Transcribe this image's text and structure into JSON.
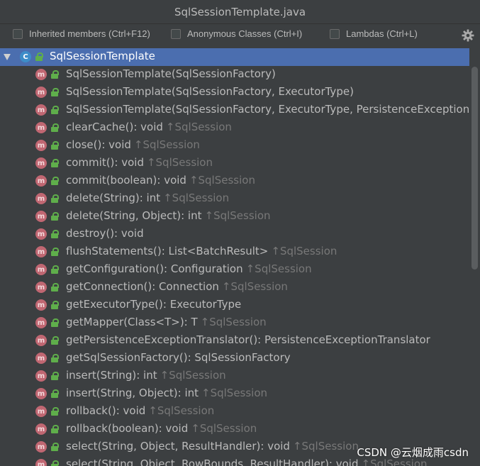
{
  "window": {
    "title": "SqlSessionTemplate.java"
  },
  "toolbar": {
    "checkboxes": [
      {
        "label": "Inherited members (Ctrl+F12)",
        "checked": false
      },
      {
        "label": "Anonymous Classes (Ctrl+I)",
        "checked": false
      },
      {
        "label": "Lambdas (Ctrl+L)",
        "checked": false
      }
    ],
    "settings_icon": "gear-icon"
  },
  "tree": {
    "root": {
      "label": "SqlSessionTemplate",
      "icon": "class-icon",
      "expanded": true
    },
    "members": [
      {
        "name": "SqlSessionTemplate(SqlSessionFactory)",
        "inherited": ""
      },
      {
        "name": "SqlSessionTemplate(SqlSessionFactory, ExecutorType)",
        "inherited": ""
      },
      {
        "name": "SqlSessionTemplate(SqlSessionFactory, ExecutorType, PersistenceExceptionTran",
        "inherited": ""
      },
      {
        "name": "clearCache(): void",
        "inherited": "↑SqlSession"
      },
      {
        "name": "close(): void",
        "inherited": "↑SqlSession"
      },
      {
        "name": "commit(): void",
        "inherited": "↑SqlSession"
      },
      {
        "name": "commit(boolean): void",
        "inherited": "↑SqlSession"
      },
      {
        "name": "delete(String): int",
        "inherited": "↑SqlSession"
      },
      {
        "name": "delete(String, Object): int",
        "inherited": "↑SqlSession"
      },
      {
        "name": "destroy(): void",
        "inherited": ""
      },
      {
        "name": "flushStatements(): List<BatchResult>",
        "inherited": "↑SqlSession"
      },
      {
        "name": "getConfiguration(): Configuration",
        "inherited": "↑SqlSession"
      },
      {
        "name": "getConnection(): Connection",
        "inherited": "↑SqlSession"
      },
      {
        "name": "getExecutorType(): ExecutorType",
        "inherited": ""
      },
      {
        "name": "getMapper(Class<T>): T",
        "inherited": "↑SqlSession"
      },
      {
        "name": "getPersistenceExceptionTranslator(): PersistenceExceptionTranslator",
        "inherited": ""
      },
      {
        "name": "getSqlSessionFactory(): SqlSessionFactory",
        "inherited": ""
      },
      {
        "name": "insert(String): int",
        "inherited": "↑SqlSession"
      },
      {
        "name": "insert(String, Object): int",
        "inherited": "↑SqlSession"
      },
      {
        "name": "rollback(): void",
        "inherited": "↑SqlSession"
      },
      {
        "name": "rollback(boolean): void",
        "inherited": "↑SqlSession"
      },
      {
        "name": "select(String, Object, ResultHandler): void",
        "inherited": "↑SqlSession"
      },
      {
        "name": "select(String, Object, RowBounds, ResultHandler): void",
        "inherited": "↑SqlSession"
      }
    ],
    "member_icon_letter": "m",
    "class_icon_letter": "C"
  },
  "watermark": "CSDN @云烟成雨csdn"
}
